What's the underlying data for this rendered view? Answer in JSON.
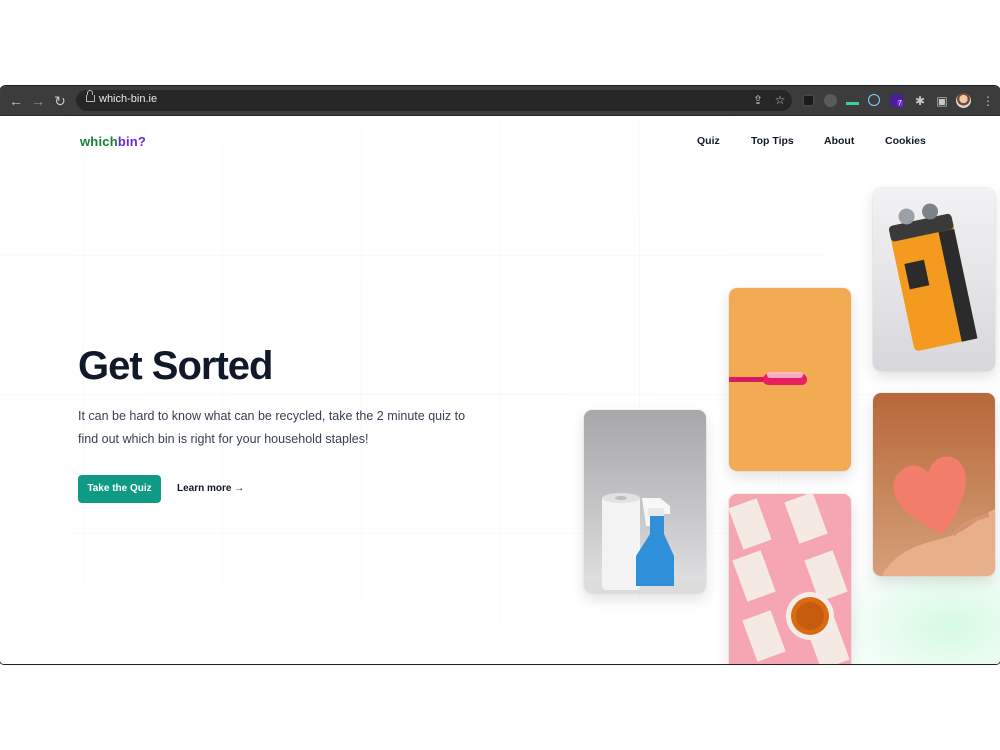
{
  "browser": {
    "url": "which-bin.ie",
    "extension_badge": "7",
    "icons": [
      "back-icon",
      "forward-icon",
      "reload-icon",
      "share-icon",
      "bookmark-star-icon",
      "extensions-puzzle-icon",
      "side-panel-icon",
      "profile-avatar",
      "menu-dots-icon"
    ]
  },
  "site": {
    "logo_which": "which",
    "logo_bin": "bin?",
    "nav": [
      "Quiz",
      "Top Tips",
      "About",
      "Cookies"
    ]
  },
  "hero": {
    "title": "Get Sorted",
    "subtitle": "It can be hard to know what can be recycled, take the 2 minute quiz to find out which bin is right for your household staples!",
    "cta_label": "Take the Quiz",
    "learn_more_label": "Learn more →"
  },
  "images": [
    {
      "name": "cleaning-products-photo",
      "subject": "paper towel roll and blue spray bottle"
    },
    {
      "name": "toothbrush-photo",
      "subject": "pink toothbrush on orange background"
    },
    {
      "name": "paper-cups-photo",
      "subject": "patterned paper cups with tea on pink background"
    },
    {
      "name": "battery-photo",
      "subject": "9V industrial battery"
    },
    {
      "name": "sponge-heart-photo",
      "subject": "heart-shaped sponge held in hand"
    }
  ],
  "colors": {
    "brand_green": "#15803d",
    "brand_purple": "#6d28d9",
    "cta": "#0f9a85",
    "text_dark": "#111827"
  }
}
